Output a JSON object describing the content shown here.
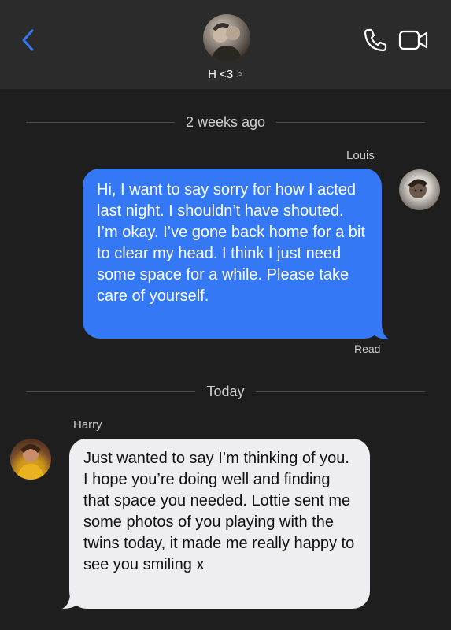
{
  "header": {
    "contact_name": "H <3",
    "contact_chevron": ">",
    "back_icon": "chevron-left-icon",
    "call_icon": "phone-icon",
    "video_icon": "video-camera-icon",
    "accent_color": "#3478f6"
  },
  "conversation": {
    "sections": [
      {
        "timestamp": "2 weeks ago",
        "sender": "Louis",
        "message": "Hi, I want to say sorry for how I acted last night. I shouldn’t have shouted. I’m okay. I’ve gone back home for a bit to clear my head. I think I just need some space for a while. Please take care of yourself.",
        "status": "Read",
        "bubble_color": "#3478f6"
      },
      {
        "timestamp": "Today",
        "sender": "Harry",
        "message": "Just wanted to say I’m thinking of you. I hope you’re doing well and finding that space you needed. Lottie sent me some photos of you playing with the twins today, it made me really happy to see you smiling x",
        "bubble_color": "#eeeef0"
      }
    ]
  }
}
